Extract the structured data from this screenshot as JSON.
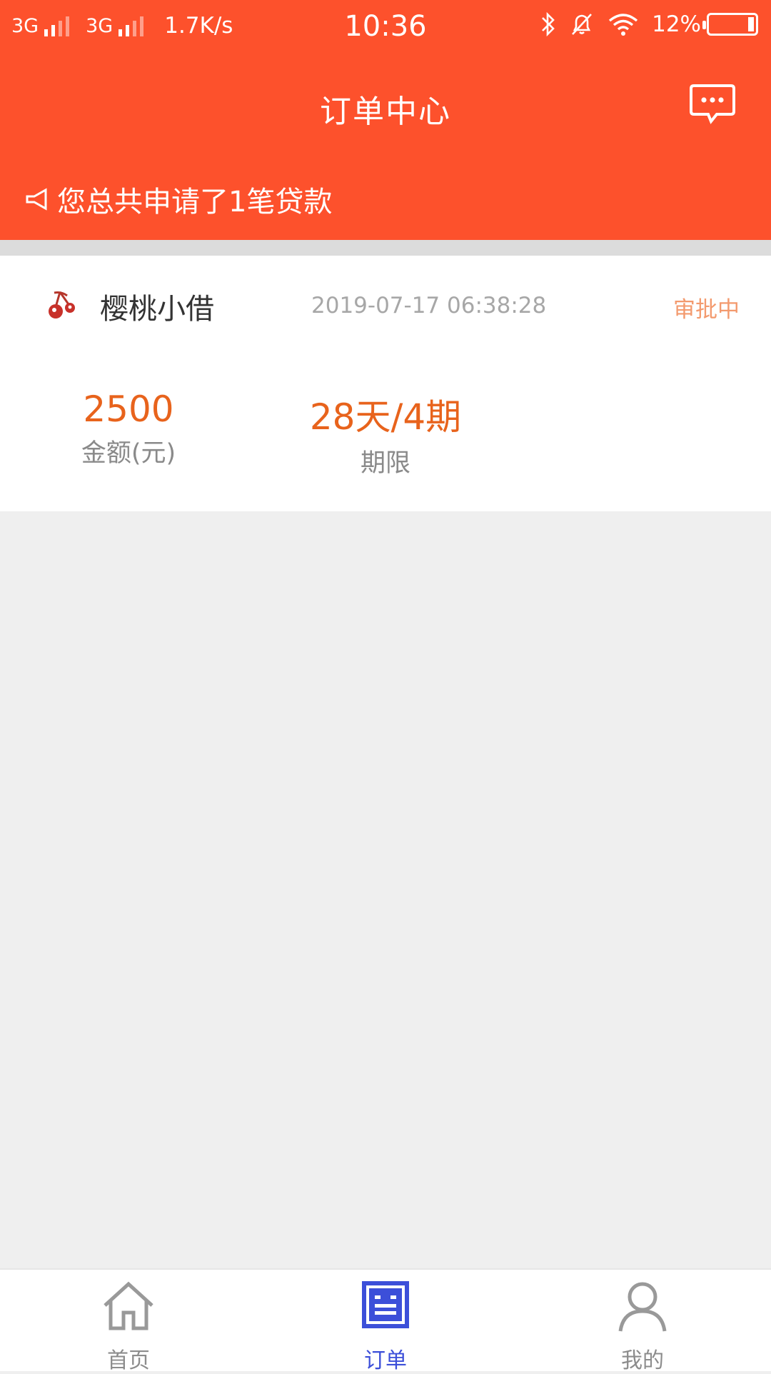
{
  "status_bar": {
    "net1": "3G",
    "net2": "3G",
    "speed": "1.7K/s",
    "time": "10:36",
    "battery": "12%"
  },
  "header": {
    "title": "订单中心",
    "notice": "您总共申请了1笔贷款"
  },
  "order": {
    "lender": "樱桃小借",
    "time": "2019-07-17 06:38:28",
    "status": "审批中",
    "amount_value": "2500",
    "amount_label": "金额(元)",
    "term_value": "28天/4期",
    "term_label": "期限"
  },
  "tabbar": {
    "items": [
      {
        "label": "首页",
        "icon": "home-icon"
      },
      {
        "label": "订单",
        "icon": "order-icon"
      },
      {
        "label": "我的",
        "icon": "person-icon"
      }
    ],
    "active": 1
  },
  "colors": {
    "brand": "#fd512c",
    "amount": "#e8631c",
    "status": "#f39a6e",
    "tab_active": "#3c4fd9",
    "tab_inactive": "#8c8c8c"
  }
}
